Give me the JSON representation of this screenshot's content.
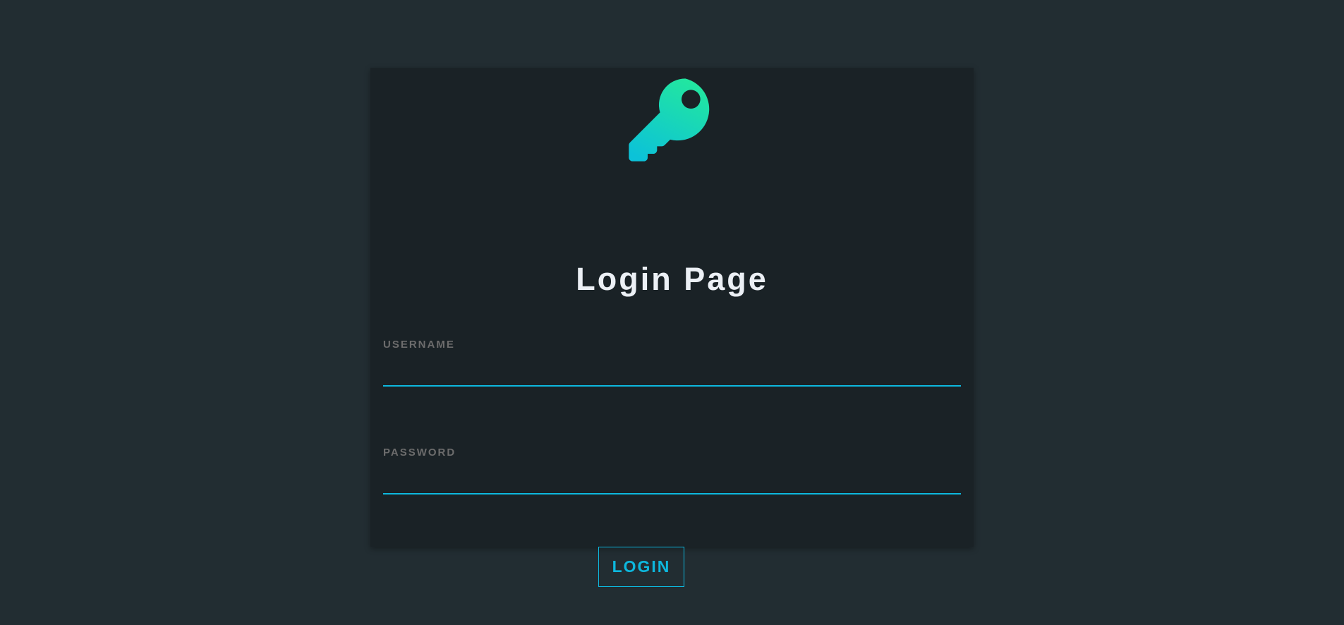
{
  "page": {
    "background_color": "#222d32",
    "card_color": "#1a2226",
    "accent_color": "#0db8de"
  },
  "header": {
    "icon": "key-icon",
    "icon_gradient": [
      "#22e6a0",
      "#0cc2d8"
    ],
    "title": "Login Page"
  },
  "form": {
    "username": {
      "label": "USERNAME",
      "value": ""
    },
    "password": {
      "label": "PASSWORD",
      "value": ""
    },
    "submit_label": "LOGIN"
  }
}
